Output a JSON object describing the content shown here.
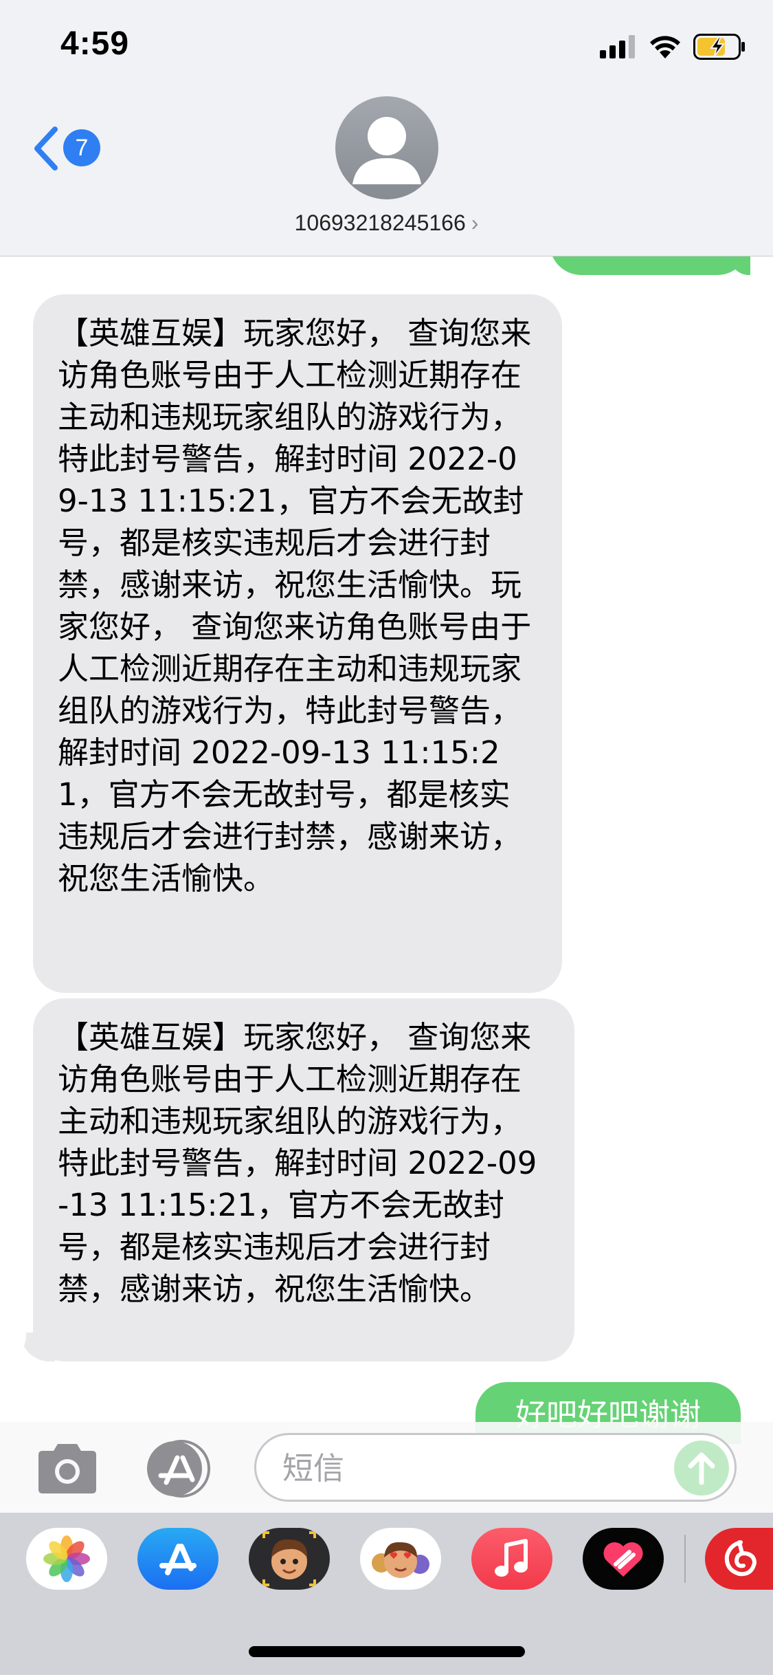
{
  "status_bar": {
    "time": "4:59"
  },
  "header": {
    "back_badge": "7",
    "contact_name": "10693218245166",
    "chevron": "›"
  },
  "messages": [
    {
      "direction": "received",
      "text": "【英雄互娱】玩家您好， 查询您来访角色账号由于人工检测近期存在主动和违规玩家组队的游戏行为，特此封号警告，解封时间 2022-09-13 11:15:21，官方不会无故封号，都是核实违规后才会进行封禁，感谢来访，祝您生活愉快。玩家您好， 查询您来访角色账号由于人工检测近期存在主动和违规玩家组队的游戏行为，特此封号警告，解封时间 2022-09-13 11:15:21，官方不会无故封号，都是核实违规后才会进行封禁，感谢来访，祝您生活愉快。"
    },
    {
      "direction": "received",
      "text": "【英雄互娱】玩家您好， 查询您来访角色账号由于人工检测近期存在主动和违规玩家组队的游戏行为，特此封号警告，解封时间 2022-09-13 11:15:21，官方不会无故封号，都是核实违规后才会进行封禁，感谢来访，祝您生活愉快。"
    },
    {
      "direction": "sent",
      "text": "好吧好吧谢谢"
    }
  ],
  "input": {
    "placeholder": "短信"
  },
  "app_drawer": {
    "apps": [
      "photos-icon",
      "app-store-icon",
      "memoji-stickers-icon",
      "animoji-icon",
      "music-icon",
      "digital-touch-icon",
      "netease-music-icon"
    ]
  },
  "colors": {
    "sent_bubble": "#65d275",
    "received_bubble": "#e9e9eb",
    "accent_blue": "#2f7ff3",
    "music_red": "#fb3c4c",
    "netease_red": "#e2262b"
  }
}
